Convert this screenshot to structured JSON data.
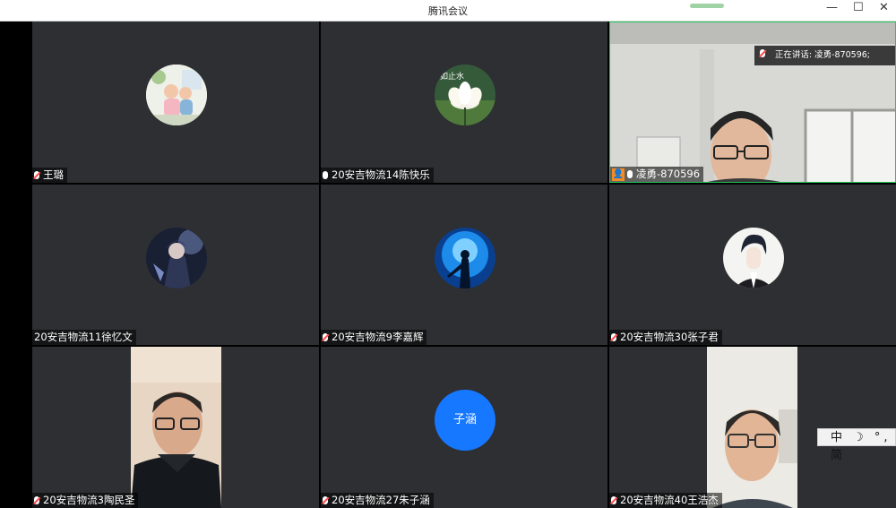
{
  "window": {
    "title": "腾讯会议"
  },
  "speaking_indicator": {
    "text": "正在讲话: 凌勇-870596;"
  },
  "participants": [
    {
      "name": "王璐",
      "mic": "muted"
    },
    {
      "name": "20安吉物流14陈快乐",
      "mic": "on",
      "avatar_text": "如止水"
    },
    {
      "name": "凌勇-870596",
      "mic": "on",
      "host": true
    },
    {
      "name": "20安吉物流11徐忆文",
      "mic": "none"
    },
    {
      "name": "20安吉物流9李嘉辉",
      "mic": "muted"
    },
    {
      "name": "20安吉物流30张子君",
      "mic": "muted"
    },
    {
      "name": "20安吉物流3陶民圣",
      "mic": "muted"
    },
    {
      "name": "20安吉物流27朱子涵",
      "mic": "muted",
      "avatar_text": "子涵"
    },
    {
      "name": "20安吉物流40王浩杰",
      "mic": "muted"
    }
  ],
  "ime_bar": {
    "text": "中 ☽ °, 简"
  },
  "colors": {
    "active_border": "#22c55e",
    "tile_bg": "#2d2f32",
    "text_avatar_bg": "#1677ff",
    "host_badge": "#f68b1f"
  }
}
